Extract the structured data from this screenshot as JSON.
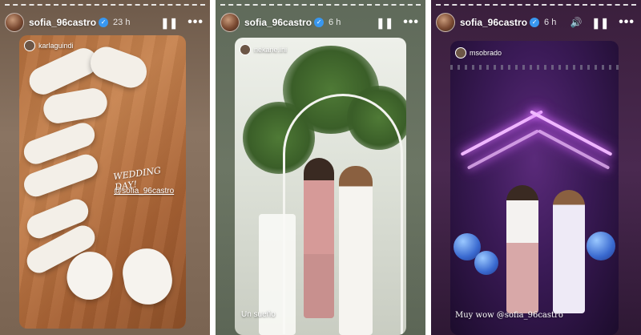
{
  "stories": [
    {
      "username": "sofia_96castro",
      "time": "23 h",
      "mention_user": "karlaguindi",
      "sticker_text": "WEDDING DAY!",
      "tag_text": "@sofia_96castro",
      "caption": ""
    },
    {
      "username": "sofia_96castro",
      "time": "6 h",
      "mention_user": "nekane.ini",
      "sticker_text": "",
      "tag_text": "",
      "caption": "Un sueño"
    },
    {
      "username": "sofia_96castro",
      "time": "6 h",
      "mention_user": "msobrado",
      "sticker_text": "",
      "tag_text": "",
      "caption": "Muy wow @sofia_96castro"
    }
  ],
  "icons": {
    "pause": "pause-icon",
    "more": "more-icon",
    "volume": "volume-icon",
    "verified": "verified-badge-icon"
  },
  "controls": {
    "pause_glyph": "❚❚",
    "more_glyph": "•••",
    "volume_glyph": "🔊",
    "verified_glyph": "✓"
  },
  "colors": {
    "verified": "#3897f0",
    "neon": "#f0b8ff"
  }
}
